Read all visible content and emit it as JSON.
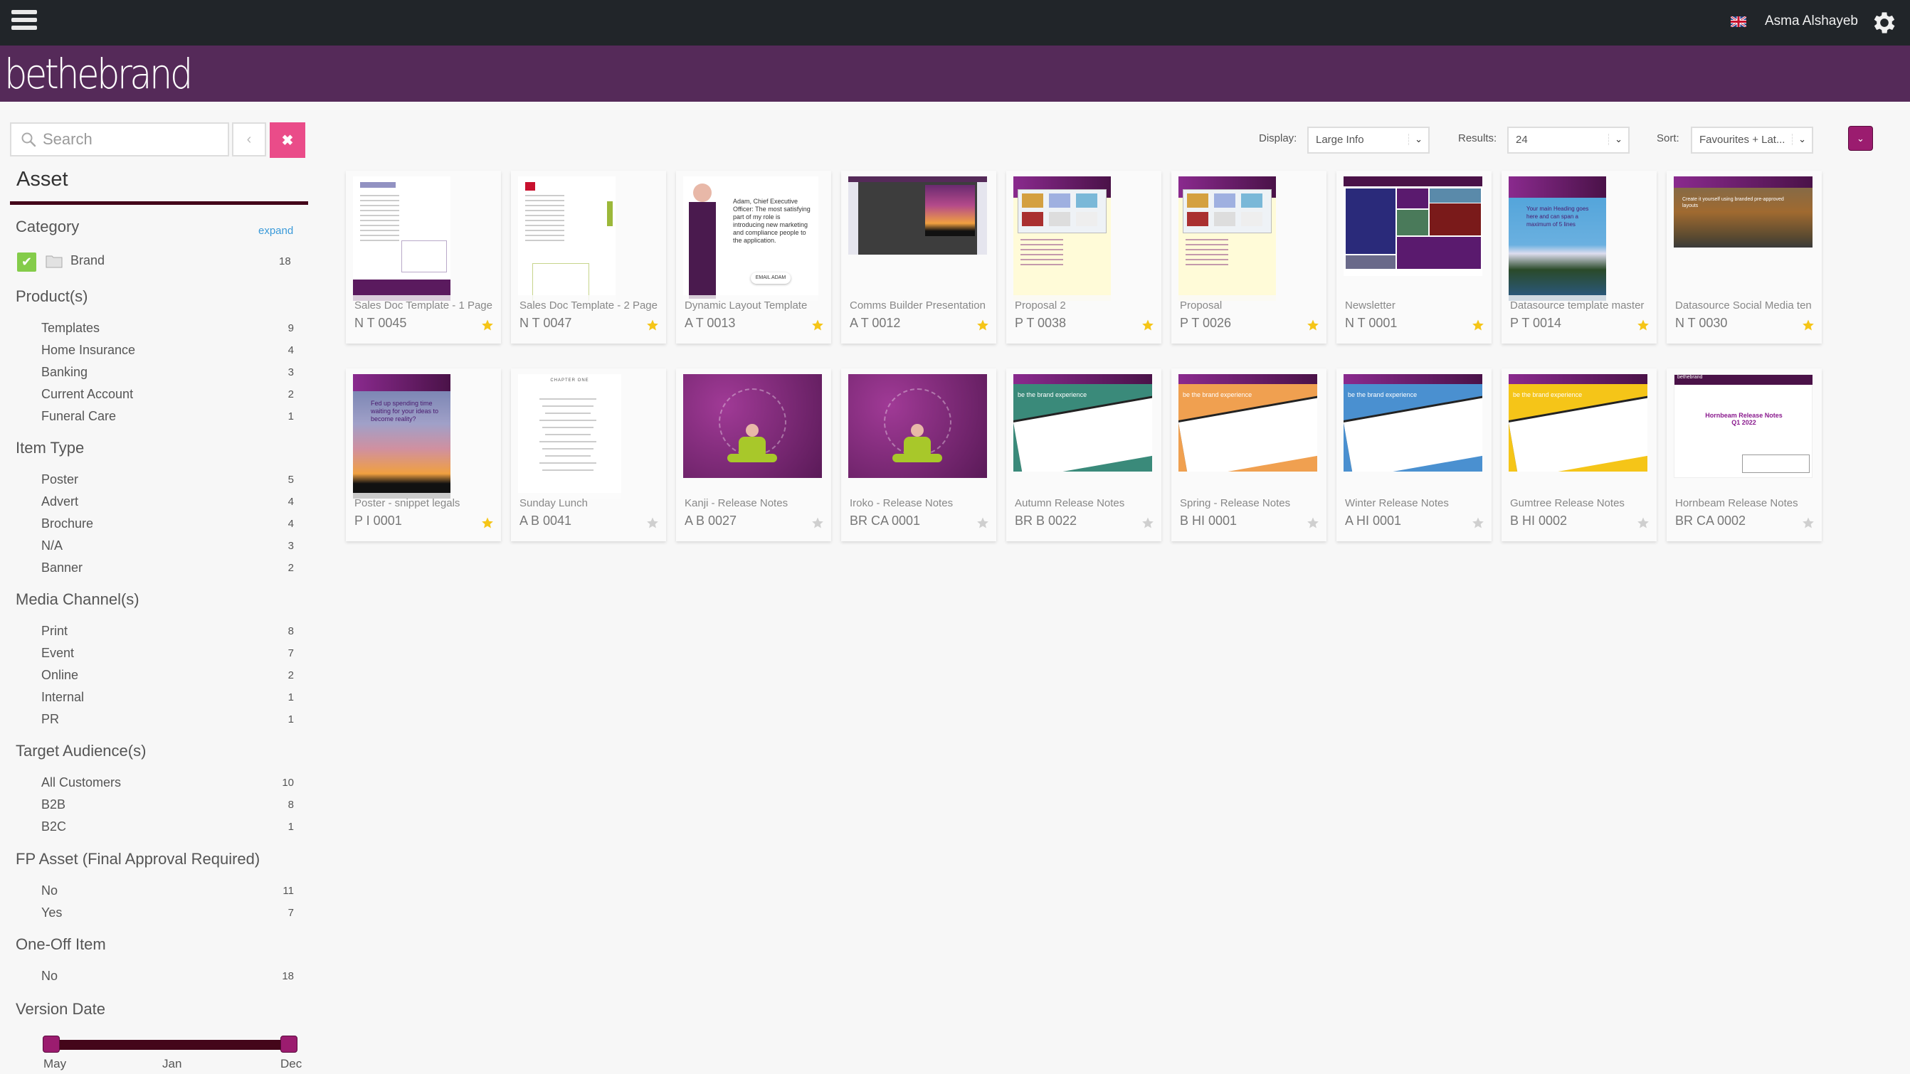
{
  "topbar": {
    "user_name": "Asma Alshayeb",
    "menu_icon": "hamburger-icon",
    "language_icon": "uk-flag-icon",
    "settings_icon": "gear-icon"
  },
  "brand": {
    "logo_text": "bethebrand",
    "brand_color": "#552a59",
    "accent_color": "#9b1c6f"
  },
  "sidebar": {
    "search_placeholder": "Search",
    "back_label": "‹",
    "clear_label": "✖",
    "asset_heading": "Asset",
    "category": {
      "title": "Category",
      "expand_label": "expand",
      "items": [
        {
          "label": "Brand",
          "count": "18",
          "checked": true
        }
      ]
    },
    "facets": [
      {
        "title": "Product(s)",
        "items": [
          {
            "label": "Templates",
            "count": "9"
          },
          {
            "label": "Home Insurance",
            "count": "4"
          },
          {
            "label": "Banking",
            "count": "3"
          },
          {
            "label": "Current Account",
            "count": "2"
          },
          {
            "label": "Funeral Care",
            "count": "1"
          }
        ]
      },
      {
        "title": "Item Type",
        "items": [
          {
            "label": "Poster",
            "count": "5"
          },
          {
            "label": "Advert",
            "count": "4"
          },
          {
            "label": "Brochure",
            "count": "4"
          },
          {
            "label": "N/A",
            "count": "3"
          },
          {
            "label": "Banner",
            "count": "2"
          }
        ]
      },
      {
        "title": "Media Channel(s)",
        "items": [
          {
            "label": "Print",
            "count": "8"
          },
          {
            "label": "Event",
            "count": "7"
          },
          {
            "label": "Online",
            "count": "2"
          },
          {
            "label": "Internal",
            "count": "1"
          },
          {
            "label": "PR",
            "count": "1"
          }
        ]
      },
      {
        "title": "Target Audience(s)",
        "items": [
          {
            "label": "All Customers",
            "count": "10"
          },
          {
            "label": "B2B",
            "count": "8"
          },
          {
            "label": "B2C",
            "count": "1"
          }
        ]
      },
      {
        "title": "FP Asset (Final Approval Required)",
        "items": [
          {
            "label": "No",
            "count": "11"
          },
          {
            "label": "Yes",
            "count": "7"
          }
        ]
      },
      {
        "title": "One-Off Item",
        "items": [
          {
            "label": "No",
            "count": "18"
          }
        ]
      }
    ],
    "version_date": {
      "title": "Version Date",
      "labels": [
        "May",
        "Jan",
        "Dec"
      ],
      "range_start": "May",
      "range_end": "Dec"
    }
  },
  "toolbar": {
    "display_label": "Display:",
    "display_value": "Large Info",
    "results_label": "Results:",
    "results_value": "24",
    "sort_label": "Sort:",
    "sort_value": "Favourites + Lat...",
    "caret": "⌄"
  },
  "assets": [
    {
      "title": "Sales Doc Template - 1 Page",
      "code": "N T 0045",
      "favourite": true,
      "thumb": "doc"
    },
    {
      "title": "Sales Doc Template - 2 Page",
      "code": "N T 0047",
      "favourite": true,
      "thumb": "doc2"
    },
    {
      "title": "Dynamic Layout Template",
      "code": "A T 0013",
      "favourite": true,
      "thumb": "adam"
    },
    {
      "title": "Comms Builder Presentation",
      "code": "A T 0012",
      "favourite": true,
      "thumb": "comms"
    },
    {
      "title": "Proposal 2",
      "code": "P T 0038",
      "favourite": true,
      "thumb": "proposal"
    },
    {
      "title": "Proposal",
      "code": "P T 0026",
      "favourite": true,
      "thumb": "proposal"
    },
    {
      "title": "Newsletter",
      "code": "N T 0001",
      "favourite": true,
      "thumb": "newsletter"
    },
    {
      "title": "Datasource template master",
      "code": "P T 0014",
      "favourite": true,
      "thumb": "lake"
    },
    {
      "title": "Datasource Social Media ten",
      "code": "N T 0030",
      "favourite": true,
      "thumb": "forest"
    },
    {
      "title": "Poster - snippet legals",
      "code": "P I 0001",
      "favourite": true,
      "thumb": "sunset"
    },
    {
      "title": "Sunday Lunch",
      "code": "A B 0041",
      "favourite": false,
      "thumb": "menu"
    },
    {
      "title": "Kanji - Release Notes",
      "code": "A B 0027",
      "favourite": false,
      "thumb": "meditate"
    },
    {
      "title": "Iroko - Release Notes",
      "code": "BR CA 0001",
      "favourite": false,
      "thumb": "meditate"
    },
    {
      "title": "Autumn Release Notes",
      "code": "BR B 0022",
      "favourite": false,
      "thumb": "teal"
    },
    {
      "title": "Spring - Release Notes",
      "code": "B HI 0001",
      "favourite": false,
      "thumb": "orange"
    },
    {
      "title": "Winter Release Notes",
      "code": "A HI 0001",
      "favourite": false,
      "thumb": "blue"
    },
    {
      "title": "Gumtree Release Notes",
      "code": "B HI 0002",
      "favourite": false,
      "thumb": "yellow"
    },
    {
      "title": "Hornbeam Release Notes",
      "code": "BR CA 0002",
      "favourite": false,
      "thumb": "hornbeam"
    }
  ]
}
